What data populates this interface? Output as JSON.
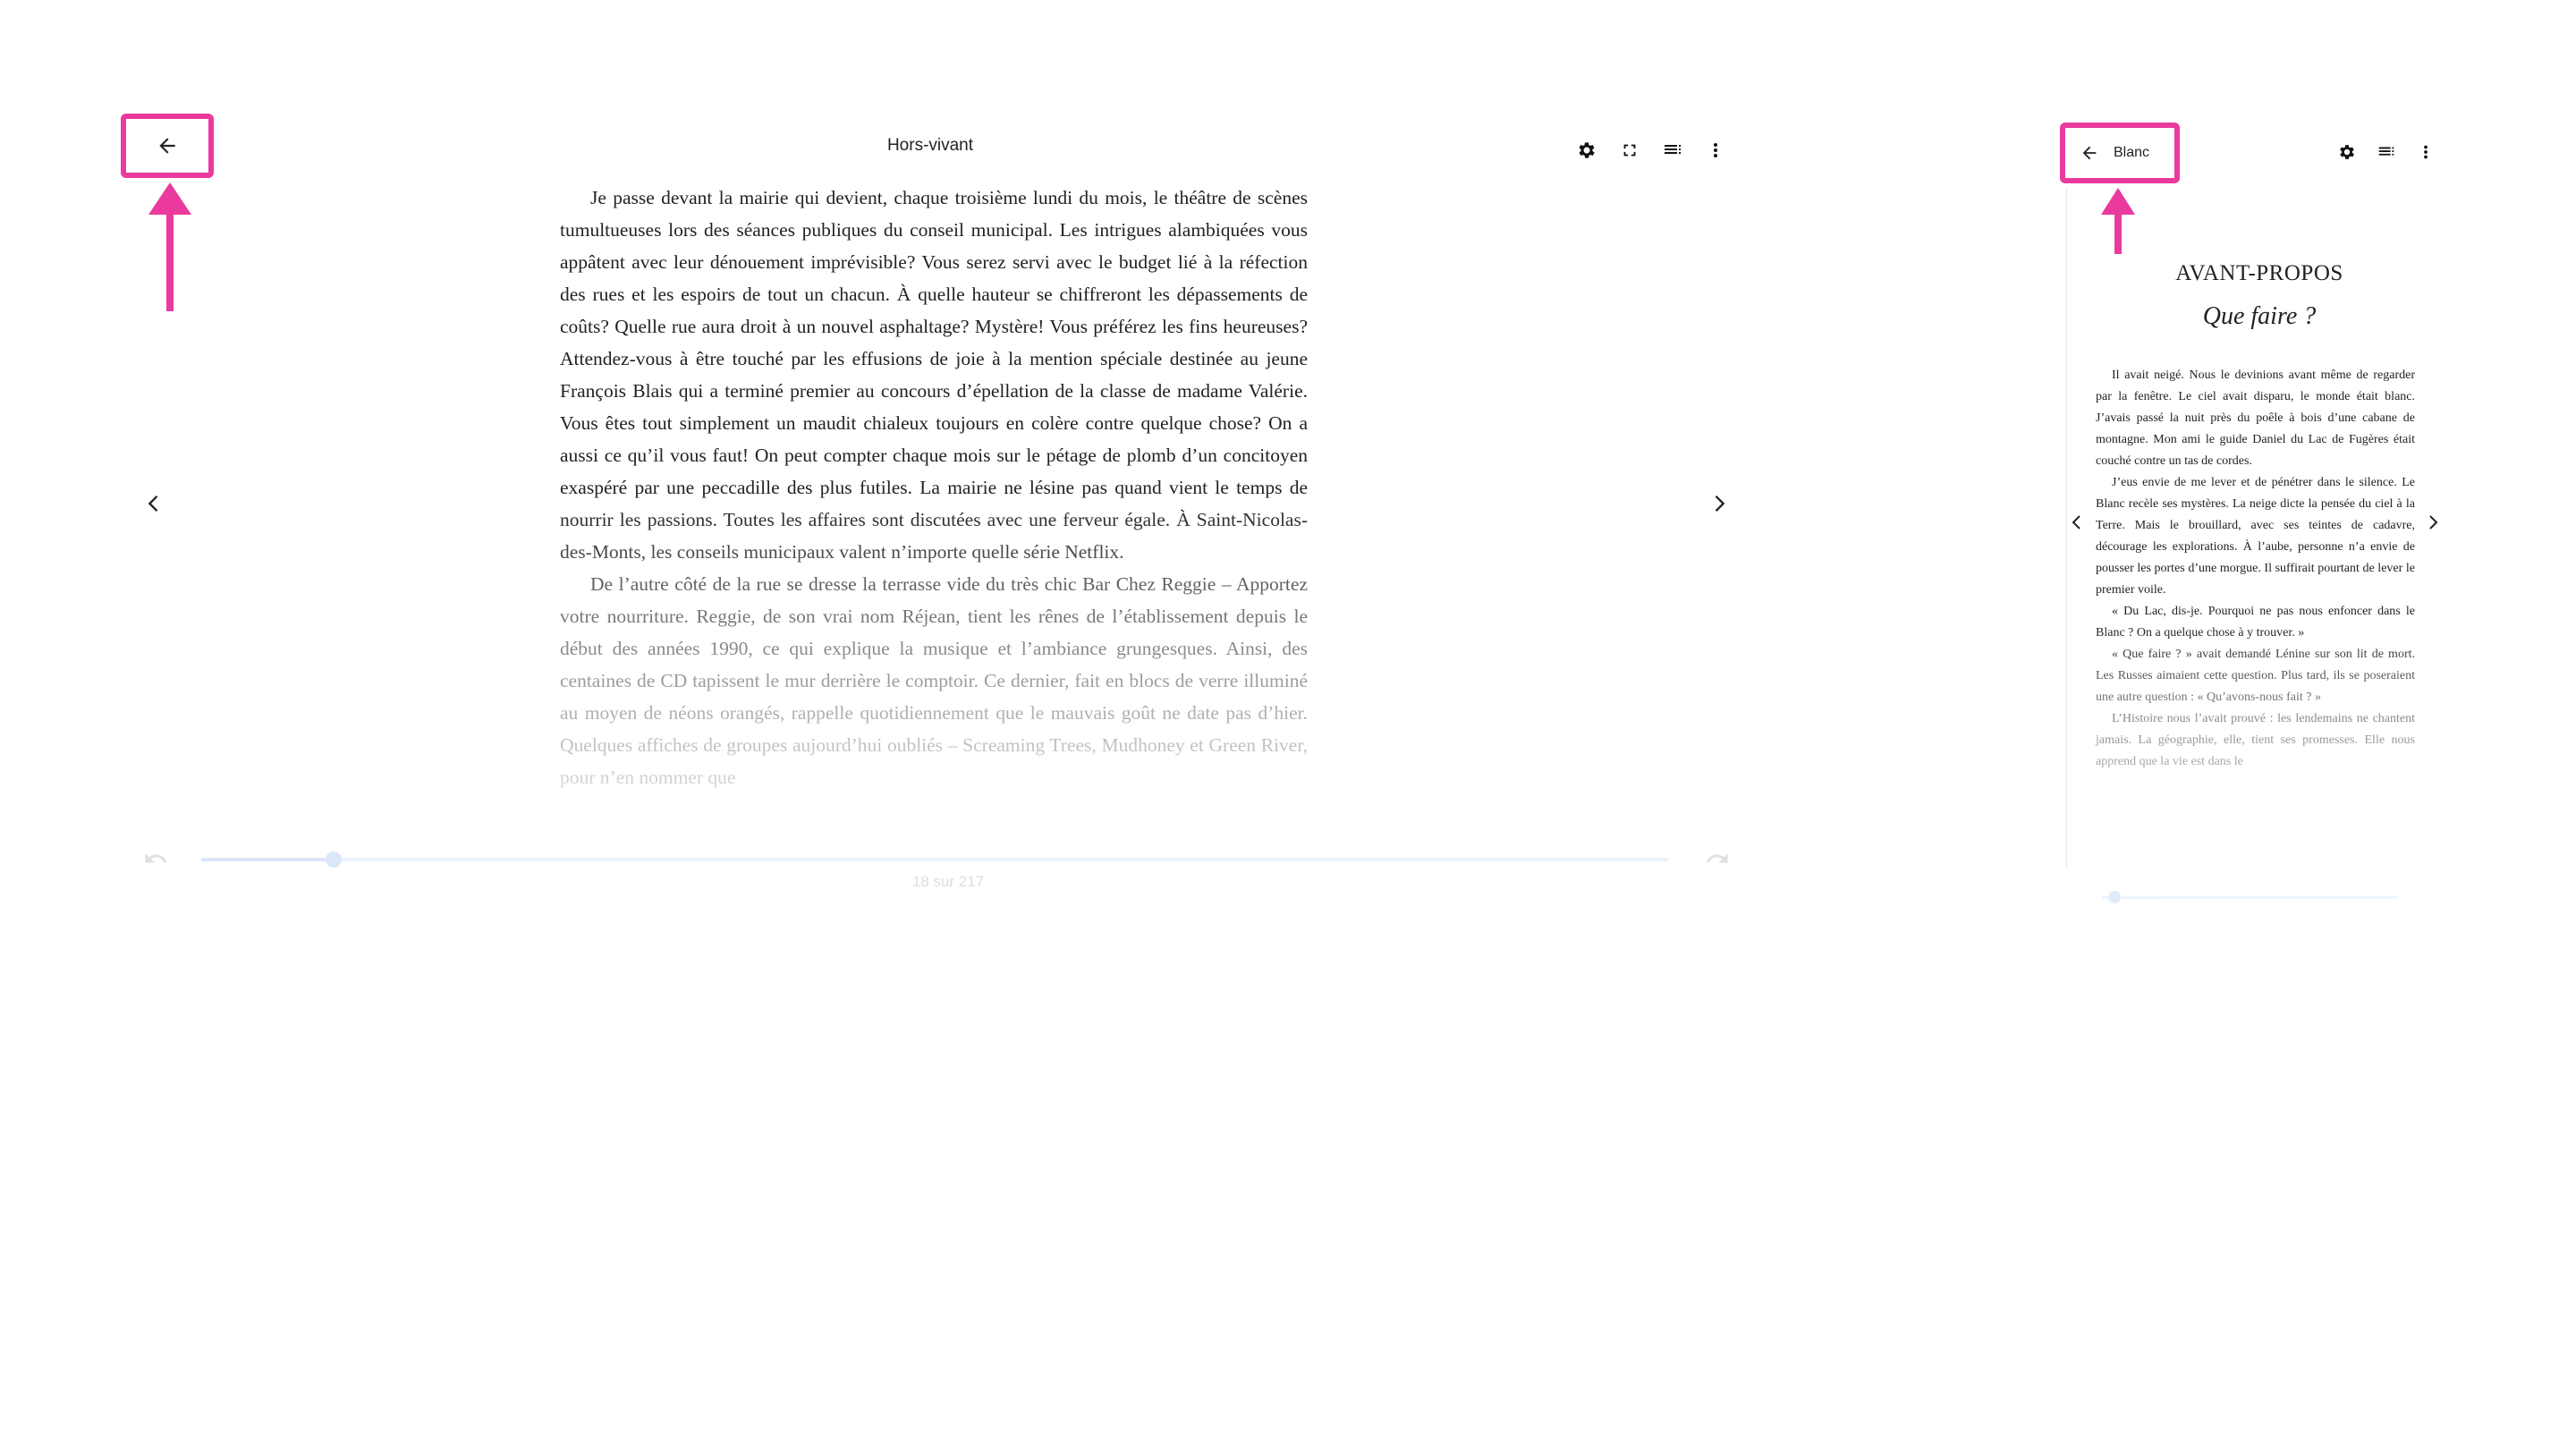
{
  "colors": {
    "highlight": "#ea3a9e",
    "text": "#222222",
    "progress": "#3b7de0"
  },
  "desktop_reader": {
    "title": "Hors-vivant",
    "back_icon": "arrow-left-icon",
    "toolbar_icons": [
      "gear-icon",
      "fullscreen-icon",
      "toc-icon",
      "more-vertical-icon"
    ],
    "prev_icon": "chevron-left-icon",
    "next_icon": "chevron-right-icon",
    "paragraphs": [
      "Je passe devant la mairie qui devient, chaque troisième lundi du mois, le théâtre de scènes tumultueuses lors des séances publiques du conseil municipal. Les intrigues alambiquées vous appâtent avec leur dénouement imprévisible? Vous serez servi avec le budget lié à la réfection des rues et les espoirs de tout un chacun. À quelle hauteur se chiffreront les dépassements de coûts? Quelle rue aura droit à un nouvel asphaltage? Mystère! Vous préférez les fins heureuses? Attendez-vous à être touché par les effusions de joie à la mention spéciale destinée au jeune François Blais qui a terminé premier au concours d’épellation de la classe de madame Valérie. Vous êtes tout simplement un maudit chialeux toujours en colère contre quelque chose? On a aussi ce qu’il vous faut! On peut compter chaque mois sur le pétage de plomb d’un concitoyen exaspéré par une peccadille des plus futiles. La mairie ne lésine pas quand vient le temps de nourrir les passions. Toutes les affaires sont discutées avec une ferveur égale. À Saint-Nicolas-des-Monts, les conseils municipaux valent n’importe quelle série Netflix.",
      "De l’autre côté de la rue se dresse la terrasse vide du très chic Bar Chez Reggie – Apportez votre nourriture. Reggie, de son vrai nom Réjean, tient les rênes de l’établissement depuis le début des années 1990, ce qui explique la musique et l’ambiance grungesques. Ainsi, des centaines de CD tapissent le mur derrière le comptoir. Ce dernier, fait en blocs de verre illuminé au moyen de néons orangés, rappelle quotidiennement que le mauvais goût ne date pas d’hier. Quelques affiches de groupes aujourd’hui oubliés – Screaming Trees, Mudhoney et Green River, pour n’en nommer que"
    ],
    "progress_fraction": 0.09,
    "page_indicator": "18 sur 217",
    "undo_icon": "undo-icon",
    "redo_icon": "redo-icon"
  },
  "mobile_reader": {
    "back_label": "Blanc",
    "back_icon": "arrow-left-icon",
    "toolbar_icons": [
      "gear-icon",
      "toc-icon",
      "more-vertical-icon"
    ],
    "chapter_heading": "AVANT-PROPOS",
    "chapter_subtitle": "Que faire ?",
    "paragraphs": [
      "Il avait neigé. Nous le devinions avant même de regarder par la fenêtre. Le ciel avait disparu, le monde était blanc. J’avais passé la nuit près du poêle à bois d’une cabane de montagne. Mon ami le guide Daniel du Lac de Fugères était couché contre un tas de cordes.",
      "J’eus envie de me lever et de pénétrer dans le silence. Le Blanc recèle ses mystères. La neige dicte la pensée du ciel à la Terre. Mais le brouillard, avec ses teintes de cadavre, décourage les explorations. À l’aube, personne n’a envie de pousser les portes d’une morgue. Il suffirait pourtant de lever le premier voile.",
      "« Du Lac, dis-je. Pourquoi ne pas nous enfoncer dans le Blanc ? On a quelque chose à y trouver. »",
      "« Que faire ? » avait demandé Lénine sur son lit de mort. Les Russes aimaient cette question. Plus tard, ils se poseraient une autre question : « Qu’avons-nous fait ? »",
      "L’Histoire nous l’avait prouvé : les lendemains ne chantent jamais. La géographie, elle, tient ses promesses. Elle nous apprend que la vie est dans le"
    ],
    "prev_icon": "chevron-left-icon",
    "next_icon": "chevron-right-icon",
    "progress_fraction": 0.02
  }
}
